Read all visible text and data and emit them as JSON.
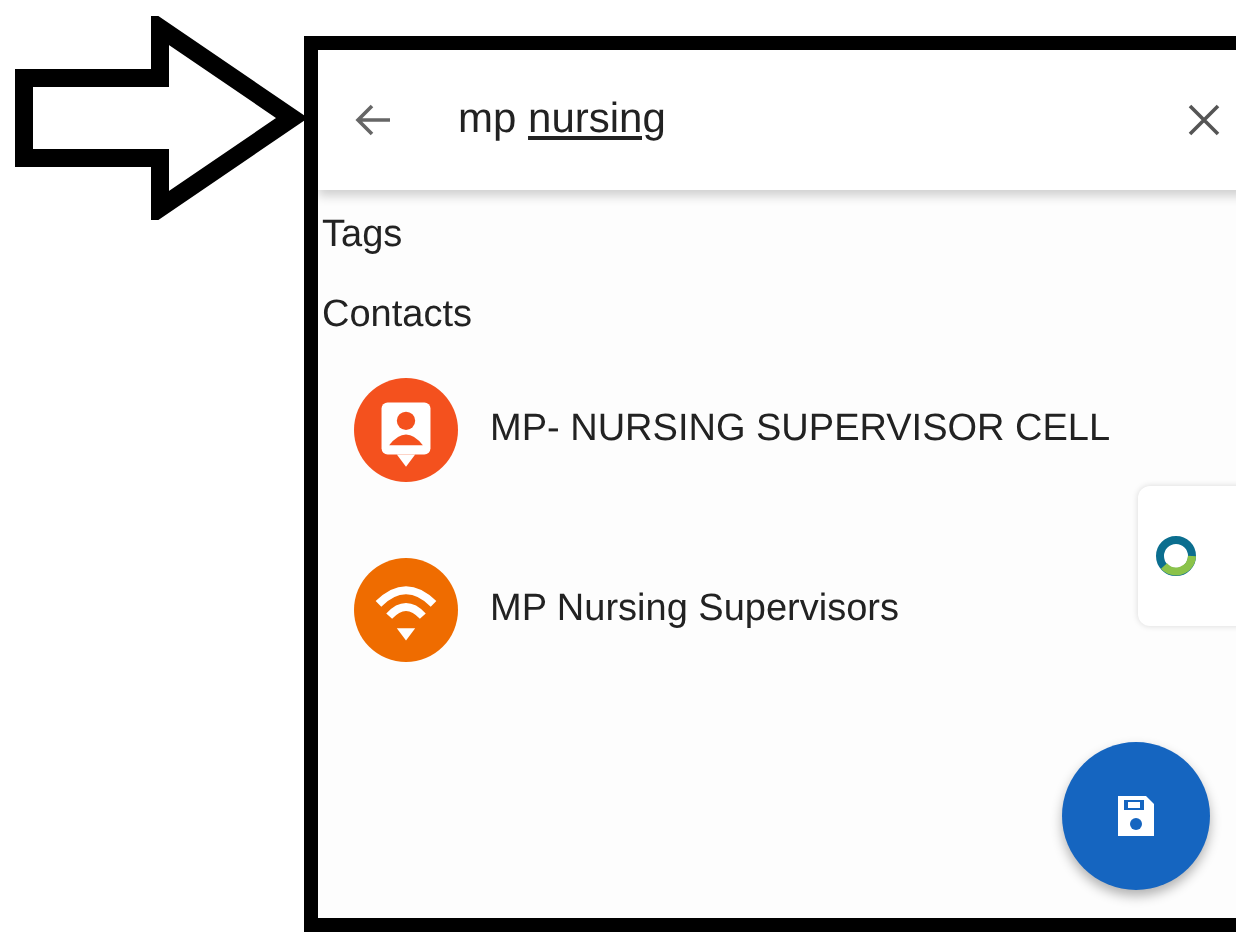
{
  "search": {
    "query_parts": [
      {
        "text": "mp ",
        "underlined": false
      },
      {
        "text": "nursing",
        "underlined": true
      }
    ]
  },
  "sections": [
    {
      "title": "Tags"
    },
    {
      "title": "Contacts"
    }
  ],
  "contacts": [
    {
      "name": "MP- NURSING SUPERVISOR CELL",
      "kind": "contact",
      "color": "#f4511e"
    },
    {
      "name": "MP Nursing Supervisors",
      "kind": "group",
      "color": "#ef6c00"
    }
  ]
}
